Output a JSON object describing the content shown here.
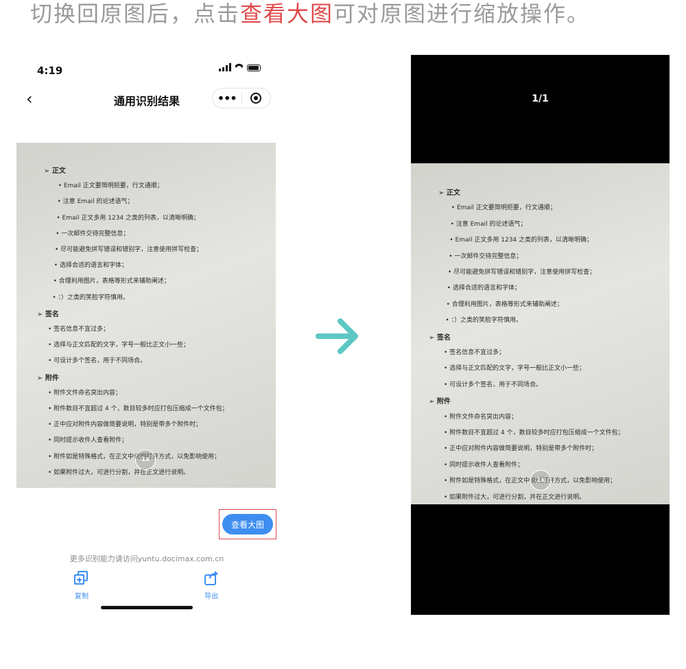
{
  "caption": {
    "before": "切换回原图后，点击",
    "highlight": "查看大图",
    "after": "可对原图进行缩放操作。"
  },
  "phone": {
    "time": "4:19",
    "nav_title": "通用识别结果",
    "capsule_more": "•••",
    "view_large_button": "查看大图",
    "more_text": "更多识别能力请访问yuntu.docimax.com.cn",
    "actions": [
      {
        "label": "复制",
        "icon": "copy-add-icon"
      },
      {
        "label": "导出",
        "icon": "export-icon"
      }
    ],
    "zoom_badge": "1x"
  },
  "viewer": {
    "page_indicator": "1/1",
    "zoom_badge": "1x"
  },
  "document_lines": [
    {
      "text": "➢  正文",
      "h": true
    },
    {
      "text": "• Email 正文要简明扼要，行文通顺；"
    },
    {
      "text": "• 注意 Email 的论述语气；"
    },
    {
      "text": "• Email 正文多用 1234 之类的列表，以清晰明确；"
    },
    {
      "text": "• 一次邮件交待完整信息；"
    },
    {
      "text": "• 尽可能避免拼写错误和错别字，注意使用拼写检查；"
    },
    {
      "text": "• 选择合适的语言和字体；"
    },
    {
      "text": "• 合理利用图片，表格等形式来辅助阐述；"
    },
    {
      "text": "• ：）之类的笑脸字符慎用。"
    },
    {
      "text": "➢ 签名",
      "h": true
    },
    {
      "text": "• 签名信息不宜过多；"
    },
    {
      "text": "• 选择与正文匹配的文字，字号一般比正文小一些；"
    },
    {
      "text": "• 可设计多个签名，用于不同场合。"
    },
    {
      "text": "➢ 附件",
      "h": true
    },
    {
      "text": "• 附件文件命名突出内容；"
    },
    {
      "text": "• 附件数目不宜超过 4 个，数目较多时应打包压缩成一个文件包；"
    },
    {
      "text": "• 正中应对附件内容做简要说明，特别是带多个附件时；"
    },
    {
      "text": "• 同时提示收件人查看附件；"
    },
    {
      "text": "• 附件如是特殊格式，在正文中说明打开方式，以免影响使用；"
    },
    {
      "text": "• 如果附件过大，可进行分割，并在正文进行说明。"
    }
  ],
  "colors": {
    "accent_blue": "#3d8ef0",
    "highlight_red": "#e04a4a",
    "arrow_teal": "#5ec8c4"
  }
}
